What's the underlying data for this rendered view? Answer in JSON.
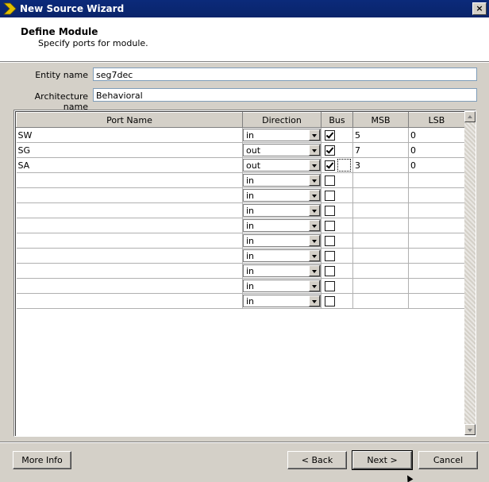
{
  "window": {
    "title": "New Source Wizard",
    "close_glyph": "×"
  },
  "header": {
    "title": "Define Module",
    "subtitle": "Specify ports for module."
  },
  "fields": {
    "entity_label": "Entity name",
    "entity_value": "seg7dec",
    "architecture_label": "Architecture name",
    "architecture_value": "Behavioral"
  },
  "table": {
    "columns": [
      "Port Name",
      "Direction",
      "Bus",
      "MSB",
      "LSB"
    ],
    "rows": [
      {
        "name": "SW",
        "direction": "in",
        "bus": true,
        "msb": "5",
        "lsb": "0"
      },
      {
        "name": "SG",
        "direction": "out",
        "bus": true,
        "msb": "7",
        "lsb": "0"
      },
      {
        "name": "SA",
        "direction": "out",
        "bus": true,
        "msb": "3",
        "lsb": "0"
      },
      {
        "name": "",
        "direction": "in",
        "bus": false,
        "msb": "",
        "lsb": ""
      },
      {
        "name": "",
        "direction": "in",
        "bus": false,
        "msb": "",
        "lsb": ""
      },
      {
        "name": "",
        "direction": "in",
        "bus": false,
        "msb": "",
        "lsb": ""
      },
      {
        "name": "",
        "direction": "in",
        "bus": false,
        "msb": "",
        "lsb": ""
      },
      {
        "name": "",
        "direction": "in",
        "bus": false,
        "msb": "",
        "lsb": ""
      },
      {
        "name": "",
        "direction": "in",
        "bus": false,
        "msb": "",
        "lsb": ""
      },
      {
        "name": "",
        "direction": "in",
        "bus": false,
        "msb": "",
        "lsb": ""
      },
      {
        "name": "",
        "direction": "in",
        "bus": false,
        "msb": "",
        "lsb": ""
      },
      {
        "name": "",
        "direction": "in",
        "bus": false,
        "msb": "",
        "lsb": ""
      }
    ]
  },
  "buttons": {
    "more_info": "More Info",
    "back": "< Back",
    "next": "Next >",
    "cancel": "Cancel"
  },
  "colors": {
    "titlebar": "#0a246a",
    "face": "#d4d0c8",
    "logo": "#e0c000"
  }
}
